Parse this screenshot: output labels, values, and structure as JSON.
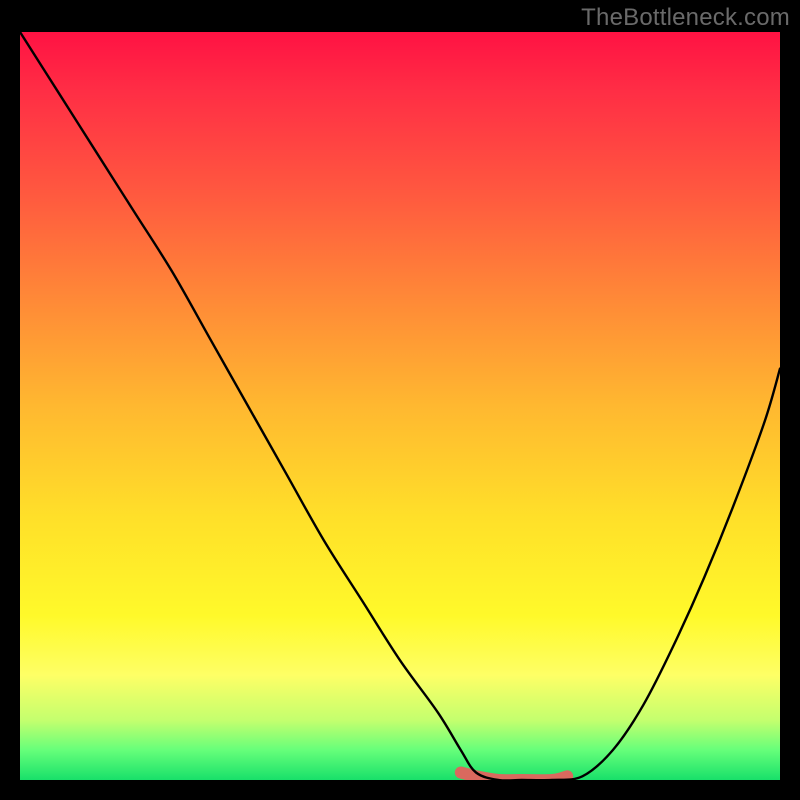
{
  "watermark": "TheBottleneck.com",
  "chart_data": {
    "type": "line",
    "title": "",
    "xlabel": "",
    "ylabel": "",
    "xlim": [
      0,
      100
    ],
    "ylim": [
      0,
      100
    ],
    "grid": false,
    "series": [
      {
        "name": "bottleneck-curve",
        "x": [
          0,
          5,
          10,
          15,
          20,
          25,
          30,
          35,
          40,
          45,
          50,
          55,
          58,
          60,
          63,
          66,
          70,
          74,
          78,
          82,
          86,
          90,
          94,
          98,
          100
        ],
        "values": [
          100,
          92,
          84,
          76,
          68,
          59,
          50,
          41,
          32,
          24,
          16,
          9,
          4,
          1,
          0,
          0,
          0,
          0.5,
          4,
          10,
          18,
          27,
          37,
          48,
          55
        ]
      },
      {
        "name": "optimal-range-highlight",
        "x": [
          58,
          60,
          63,
          66,
          70,
          72
        ],
        "values": [
          1,
          0.5,
          0,
          0,
          0,
          0.5
        ]
      }
    ],
    "background_gradient_note": "vertical gradient red→orange→yellow→green (top=high bottleneck, bottom=no bottleneck)"
  }
}
